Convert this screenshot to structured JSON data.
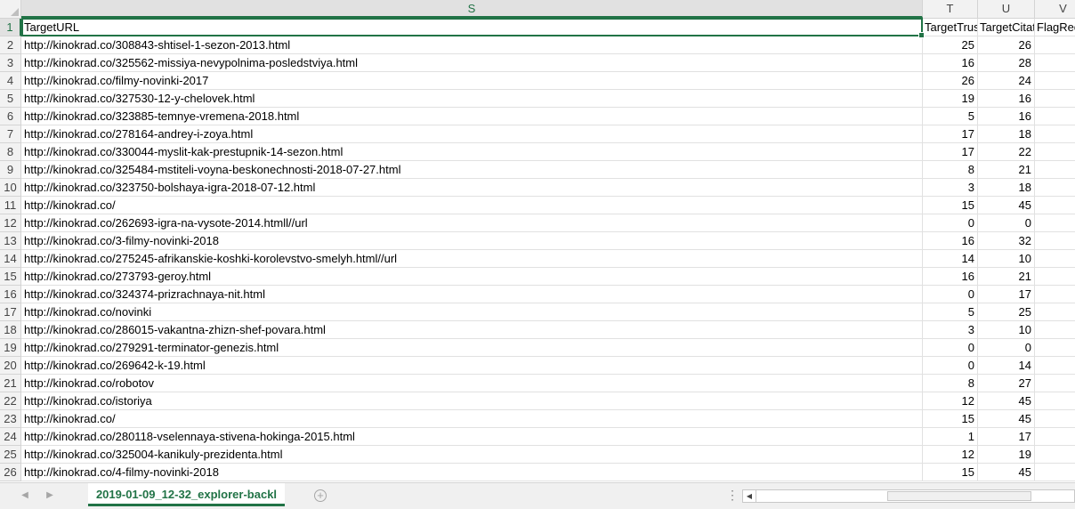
{
  "sheet": {
    "tab_name": "2019-01-09_12-32_explorer-backl",
    "add_sheet_icon": "plus-circle-icon",
    "active_cell_col": "S",
    "active_cell_row": "1"
  },
  "columns": [
    {
      "letter": "S"
    },
    {
      "letter": "T"
    },
    {
      "letter": "U"
    },
    {
      "letter": "V"
    }
  ],
  "rows": [
    {
      "n": "1",
      "s": "TargetURL",
      "t": "TargetTrust",
      "u": "TargetCitation",
      "v": "FlagRedirect"
    },
    {
      "n": "2",
      "s": "http://kinokrad.co/308843-shtisel-1-sezon-2013.html",
      "t": "25",
      "u": "26",
      "v": ""
    },
    {
      "n": "3",
      "s": "http://kinokrad.co/325562-missiya-nevypolnima-posledstviya.html",
      "t": "16",
      "u": "28",
      "v": ""
    },
    {
      "n": "4",
      "s": "http://kinokrad.co/filmy-novinki-2017",
      "t": "26",
      "u": "24",
      "v": ""
    },
    {
      "n": "5",
      "s": "http://kinokrad.co/327530-12-y-chelovek.html",
      "t": "19",
      "u": "16",
      "v": ""
    },
    {
      "n": "6",
      "s": "http://kinokrad.co/323885-temnye-vremena-2018.html",
      "t": "5",
      "u": "16",
      "v": ""
    },
    {
      "n": "7",
      "s": "http://kinokrad.co/278164-andrey-i-zoya.html",
      "t": "17",
      "u": "18",
      "v": ""
    },
    {
      "n": "8",
      "s": "http://kinokrad.co/330044-myslit-kak-prestupnik-14-sezon.html",
      "t": "17",
      "u": "22",
      "v": ""
    },
    {
      "n": "9",
      "s": "http://kinokrad.co/325484-mstiteli-voyna-beskonechnosti-2018-07-27.html",
      "t": "8",
      "u": "21",
      "v": ""
    },
    {
      "n": "10",
      "s": "http://kinokrad.co/323750-bolshaya-igra-2018-07-12.html",
      "t": "3",
      "u": "18",
      "v": ""
    },
    {
      "n": "11",
      "s": "http://kinokrad.co/",
      "t": "15",
      "u": "45",
      "v": ""
    },
    {
      "n": "12",
      "s": "http://kinokrad.co/262693-igra-na-vysote-2014.htmll//url",
      "t": "0",
      "u": "0",
      "v": ""
    },
    {
      "n": "13",
      "s": "http://kinokrad.co/3-filmy-novinki-2018",
      "t": "16",
      "u": "32",
      "v": ""
    },
    {
      "n": "14",
      "s": "http://kinokrad.co/275245-afrikanskie-koshki-korolevstvo-smelyh.html//url",
      "t": "14",
      "u": "10",
      "v": ""
    },
    {
      "n": "15",
      "s": "http://kinokrad.co/273793-geroy.html",
      "t": "16",
      "u": "21",
      "v": ""
    },
    {
      "n": "16",
      "s": "http://kinokrad.co/324374-prizrachnaya-nit.html",
      "t": "0",
      "u": "17",
      "v": ""
    },
    {
      "n": "17",
      "s": "http://kinokrad.co/novinki",
      "t": "5",
      "u": "25",
      "v": ""
    },
    {
      "n": "18",
      "s": "http://kinokrad.co/286015-vakantna-zhizn-shef-povara.html",
      "t": "3",
      "u": "10",
      "v": ""
    },
    {
      "n": "19",
      "s": "http://kinokrad.co/279291-terminator-genezis.html",
      "t": "0",
      "u": "0",
      "v": ""
    },
    {
      "n": "20",
      "s": "http://kinokrad.co/269642-k-19.html",
      "t": "0",
      "u": "14",
      "v": ""
    },
    {
      "n": "21",
      "s": "http://kinokrad.co/robotov",
      "t": "8",
      "u": "27",
      "v": ""
    },
    {
      "n": "22",
      "s": "http://kinokrad.co/istoriya",
      "t": "12",
      "u": "45",
      "v": ""
    },
    {
      "n": "23",
      "s": "http://kinokrad.co/",
      "t": "15",
      "u": "45",
      "v": ""
    },
    {
      "n": "24",
      "s": "http://kinokrad.co/280118-vselennaya-stivena-hokinga-2015.html",
      "t": "1",
      "u": "17",
      "v": ""
    },
    {
      "n": "25",
      "s": "http://kinokrad.co/325004-kanikuly-prezidenta.html",
      "t": "12",
      "u": "19",
      "v": ""
    },
    {
      "n": "26",
      "s": "http://kinokrad.co/4-filmy-novinki-2018",
      "t": "15",
      "u": "45",
      "v": ""
    }
  ]
}
